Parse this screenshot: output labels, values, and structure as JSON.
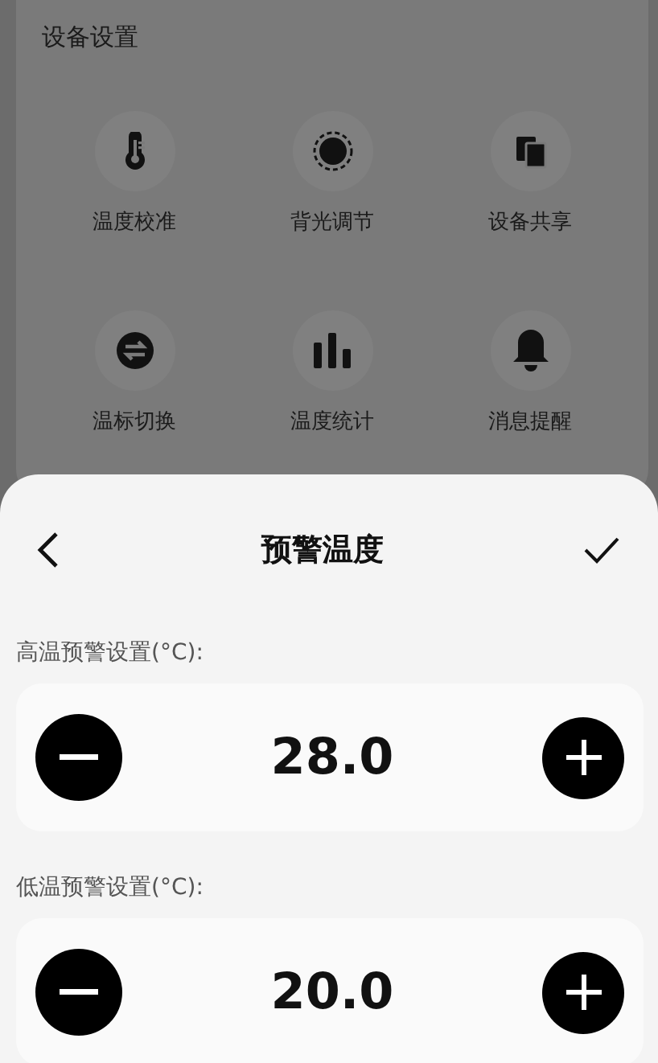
{
  "device_settings": {
    "title": "设备设置",
    "items": [
      {
        "label": "温度校准"
      },
      {
        "label": "背光调节"
      },
      {
        "label": "设备共享"
      },
      {
        "label": "温标切换"
      },
      {
        "label": "温度统计"
      },
      {
        "label": "消息提醒"
      }
    ]
  },
  "sheet": {
    "title": "预警温度",
    "steppers": [
      {
        "label": "高温预警设置(°C):",
        "value": "28.0"
      },
      {
        "label": "低温预警设置(°C):",
        "value": "20.0"
      }
    ]
  }
}
